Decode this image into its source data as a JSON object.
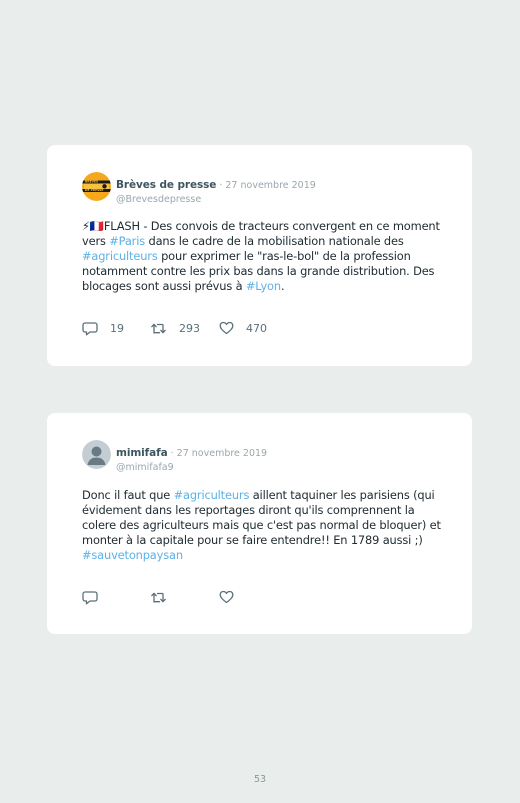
{
  "page_number": "53",
  "tweets": [
    {
      "name": "Brèves de presse",
      "separator": " · ",
      "date": "27 novembre 2019",
      "handle": "@Brevesdepresse",
      "avatar_text_top": "BRÈVES DE",
      "avatar_text_bottom": "DE PRESSE",
      "body": {
        "emoji": "⚡🇫🇷",
        "t1": "FLASH - Des convois de tracteurs convergent en ce moment vers ",
        "tag1": "#Paris",
        "t2": " dans le cadre de la mobilisation nationale des ",
        "tag2": "#agriculteurs",
        "t3": " pour exprimer le \"ras-le-bol\" de la profession notamment contre les prix bas dans la grande distribution. Des blocages sont aussi prévus à ",
        "tag3": "#Lyon",
        "t4": "."
      },
      "replies": "19",
      "retweets": "293",
      "likes": "470"
    },
    {
      "name": "mimifafa",
      "separator": " · ",
      "date": "27 novembre 2019",
      "handle": "@mimifafa9",
      "body": {
        "t1": "Donc il faut que ",
        "tag1": "#agriculteurs",
        "t2": " aillent taquiner les parisiens (qui évidement dans les reportages diront qu'ils comprennent la colere des agriculteurs mais que c'est pas normal de bloquer) et monter à la capitale pour se faire entendre!! En 1789 aussi ;) ",
        "tag2": "#sauvetonpaysan"
      },
      "replies": "",
      "retweets": "",
      "likes": ""
    }
  ]
}
